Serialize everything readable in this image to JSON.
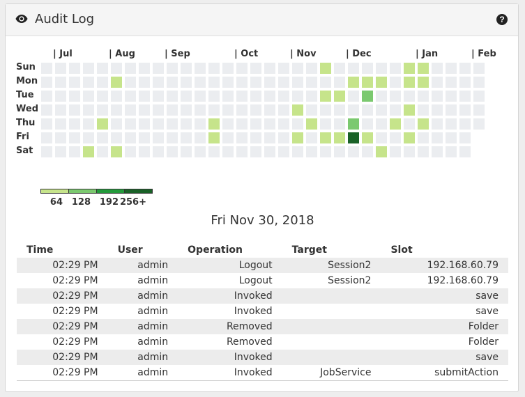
{
  "panel": {
    "title": "Audit Log",
    "title_icon": "eye-icon",
    "help_icon": "question-circle-icon",
    "help_label": "?"
  },
  "heatmap": {
    "months": [
      "| Jul",
      "| Aug",
      "| Sep",
      "| Oct",
      "| Nov",
      "| Dec",
      "| Jan",
      "| Feb"
    ],
    "month_week_index": [
      1,
      5,
      9,
      14,
      18,
      22,
      27,
      31
    ],
    "days": [
      "Sun",
      "Mon",
      "Tue",
      "Wed",
      "Thu",
      "Fri",
      "Sat"
    ],
    "weeks": 32,
    "empty_cells": [
      [
        31,
        5
      ],
      [
        31,
        6
      ]
    ],
    "active_cells": [
      {
        "week": 20,
        "day": 0,
        "level": 1
      },
      {
        "week": 26,
        "day": 0,
        "level": 1
      },
      {
        "week": 27,
        "day": 0,
        "level": 1
      },
      {
        "week": 5,
        "day": 1,
        "level": 1
      },
      {
        "week": 22,
        "day": 1,
        "level": 1
      },
      {
        "week": 23,
        "day": 1,
        "level": 1
      },
      {
        "week": 24,
        "day": 1,
        "level": 1
      },
      {
        "week": 26,
        "day": 1,
        "level": 1
      },
      {
        "week": 27,
        "day": 1,
        "level": 1
      },
      {
        "week": 20,
        "day": 2,
        "level": 1
      },
      {
        "week": 21,
        "day": 2,
        "level": 1
      },
      {
        "week": 23,
        "day": 2,
        "level": 2
      },
      {
        "week": 18,
        "day": 3,
        "level": 1
      },
      {
        "week": 26,
        "day": 3,
        "level": 1
      },
      {
        "week": 4,
        "day": 4,
        "level": 1
      },
      {
        "week": 12,
        "day": 4,
        "level": 1
      },
      {
        "week": 19,
        "day": 4,
        "level": 1
      },
      {
        "week": 22,
        "day": 4,
        "level": 2
      },
      {
        "week": 25,
        "day": 4,
        "level": 1
      },
      {
        "week": 27,
        "day": 4,
        "level": 1
      },
      {
        "week": 12,
        "day": 5,
        "level": 1
      },
      {
        "week": 18,
        "day": 5,
        "level": 1
      },
      {
        "week": 20,
        "day": 5,
        "level": 1
      },
      {
        "week": 21,
        "day": 5,
        "level": 1
      },
      {
        "week": 22,
        "day": 5,
        "level": 4
      },
      {
        "week": 23,
        "day": 5,
        "level": 1
      },
      {
        "week": 26,
        "day": 5,
        "level": 1
      },
      {
        "week": 3,
        "day": 6,
        "level": 1
      },
      {
        "week": 5,
        "day": 6,
        "level": 1
      },
      {
        "week": 24,
        "day": 6,
        "level": 1
      }
    ],
    "level_colors": [
      "#ebedf0",
      "#c6e48b",
      "#7bc96f",
      "#239a3b",
      "#196127"
    ],
    "legend": {
      "labels": [
        "64",
        "128",
        "192",
        "256+"
      ],
      "colors": [
        "#c6e48b",
        "#7bc96f",
        "#239a3b",
        "#196127"
      ]
    }
  },
  "selected_date": "Fri Nov 30, 2018",
  "table": {
    "columns": [
      "Time",
      "User",
      "Operation",
      "Target",
      "Slot"
    ],
    "rows": [
      [
        "02:29 PM",
        "admin",
        "Logout",
        "Session2",
        "192.168.60.79"
      ],
      [
        "02:29 PM",
        "admin",
        "Logout",
        "Session2",
        "192.168.60.79"
      ],
      [
        "02:29 PM",
        "admin",
        "Invoked",
        "",
        "save"
      ],
      [
        "02:29 PM",
        "admin",
        "Invoked",
        "",
        "save"
      ],
      [
        "02:29 PM",
        "admin",
        "Removed",
        "",
        "Folder"
      ],
      [
        "02:29 PM",
        "admin",
        "Removed",
        "",
        "Folder"
      ],
      [
        "02:29 PM",
        "admin",
        "Invoked",
        "",
        "save"
      ],
      [
        "02:29 PM",
        "admin",
        "Invoked",
        "JobService",
        "submitAction"
      ]
    ]
  }
}
